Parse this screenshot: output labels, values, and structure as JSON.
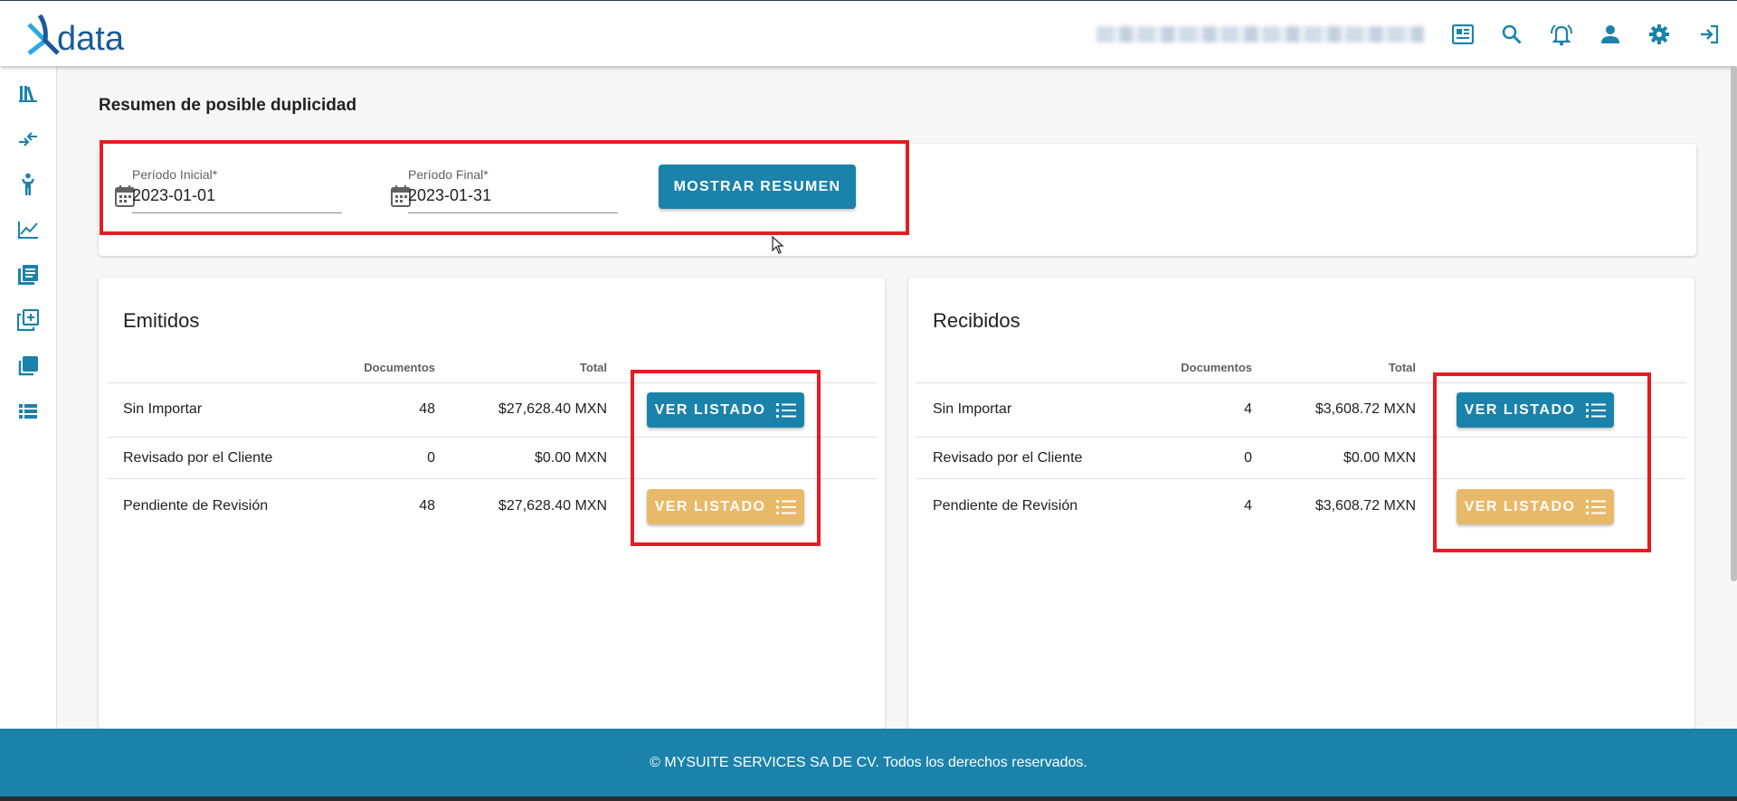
{
  "brand": {
    "name_prefix": "x",
    "name_suffix": "data",
    "primary_color": "#1a82ab",
    "accent_color": "#e9b96a"
  },
  "header": {
    "icons": [
      "newspaper-icon",
      "search-icon",
      "notification-bell-icon",
      "user-icon",
      "settings-gear-icon",
      "logout-icon"
    ]
  },
  "sidebar": {
    "icons": [
      "library-icon",
      "compare-arrows-icon",
      "accessibility-icon",
      "line-chart-icon",
      "documents-icon",
      "duplicate-icon",
      "layers-icon",
      "list-view-icon"
    ]
  },
  "page": {
    "title": "Resumen de posible duplicidad"
  },
  "filters": {
    "start": {
      "label": "Período Inicial*",
      "value": "2023-01-01"
    },
    "end": {
      "label": "Período Final*",
      "value": "2023-01-31"
    },
    "submit_label": "MOSTRAR RESUMEN"
  },
  "emitidos": {
    "title": "Emitidos",
    "columns": {
      "docs": "Documentos",
      "total": "Total"
    },
    "rows": [
      {
        "label": "Sin Importar",
        "docs": "48",
        "total": "$27,628.40 MXN"
      },
      {
        "label": "Revisado por el Cliente",
        "docs": "0",
        "total": "$0.00 MXN"
      },
      {
        "label": "Pendiente de Revisión",
        "docs": "48",
        "total": "$27,628.40 MXN"
      }
    ],
    "button_label": "VER LISTADO"
  },
  "recibidos": {
    "title": "Recibidos",
    "columns": {
      "docs": "Documentos",
      "total": "Total"
    },
    "rows": [
      {
        "label": "Sin Importar",
        "docs": "4",
        "total": "$3,608.72 MXN"
      },
      {
        "label": "Revisado por el Cliente",
        "docs": "0",
        "total": "$0.00 MXN"
      },
      {
        "label": "Pendiente de Revisión",
        "docs": "4",
        "total": "$3,608.72 MXN"
      }
    ],
    "button_label": "VER LISTADO"
  },
  "footer": {
    "text": "© MYSUITE SERVICES SA DE CV. Todos los derechos reservados."
  }
}
